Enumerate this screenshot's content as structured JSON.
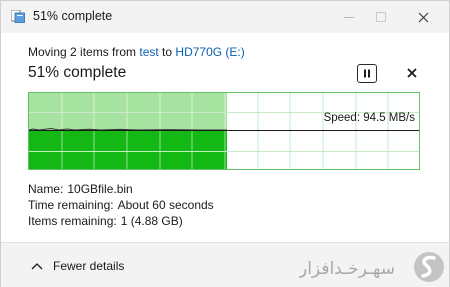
{
  "window": {
    "title": "51% complete"
  },
  "operation": {
    "moving_prefix": "Moving 2 items from ",
    "source": "test",
    "to_word": " to ",
    "destination": "HD770G (E:)",
    "percent_title": "51% complete"
  },
  "graph": {
    "progress": 0.51,
    "speed_text": "Speed: 94.5 MB/s",
    "colors": {
      "fill_light": "#a6e3a1",
      "fill_dark": "#14b814",
      "grid": "#c7ebc7",
      "border": "#66c266"
    }
  },
  "details": {
    "name_label": "Name:",
    "name_value": "10GBfile.bin",
    "time_label": "Time remaining:",
    "time_value": "About 60 seconds",
    "items_label": "Items remaining:",
    "items_value": "1 (4.88 GB)"
  },
  "footer": {
    "toggle_label": "Fewer details",
    "watermark_text": "سهـرخـدافزار"
  },
  "icons": {
    "app": "folder-copy-icon",
    "pause": "pause-icon",
    "close": "close-icon",
    "chevron": "chevron-up-icon"
  }
}
